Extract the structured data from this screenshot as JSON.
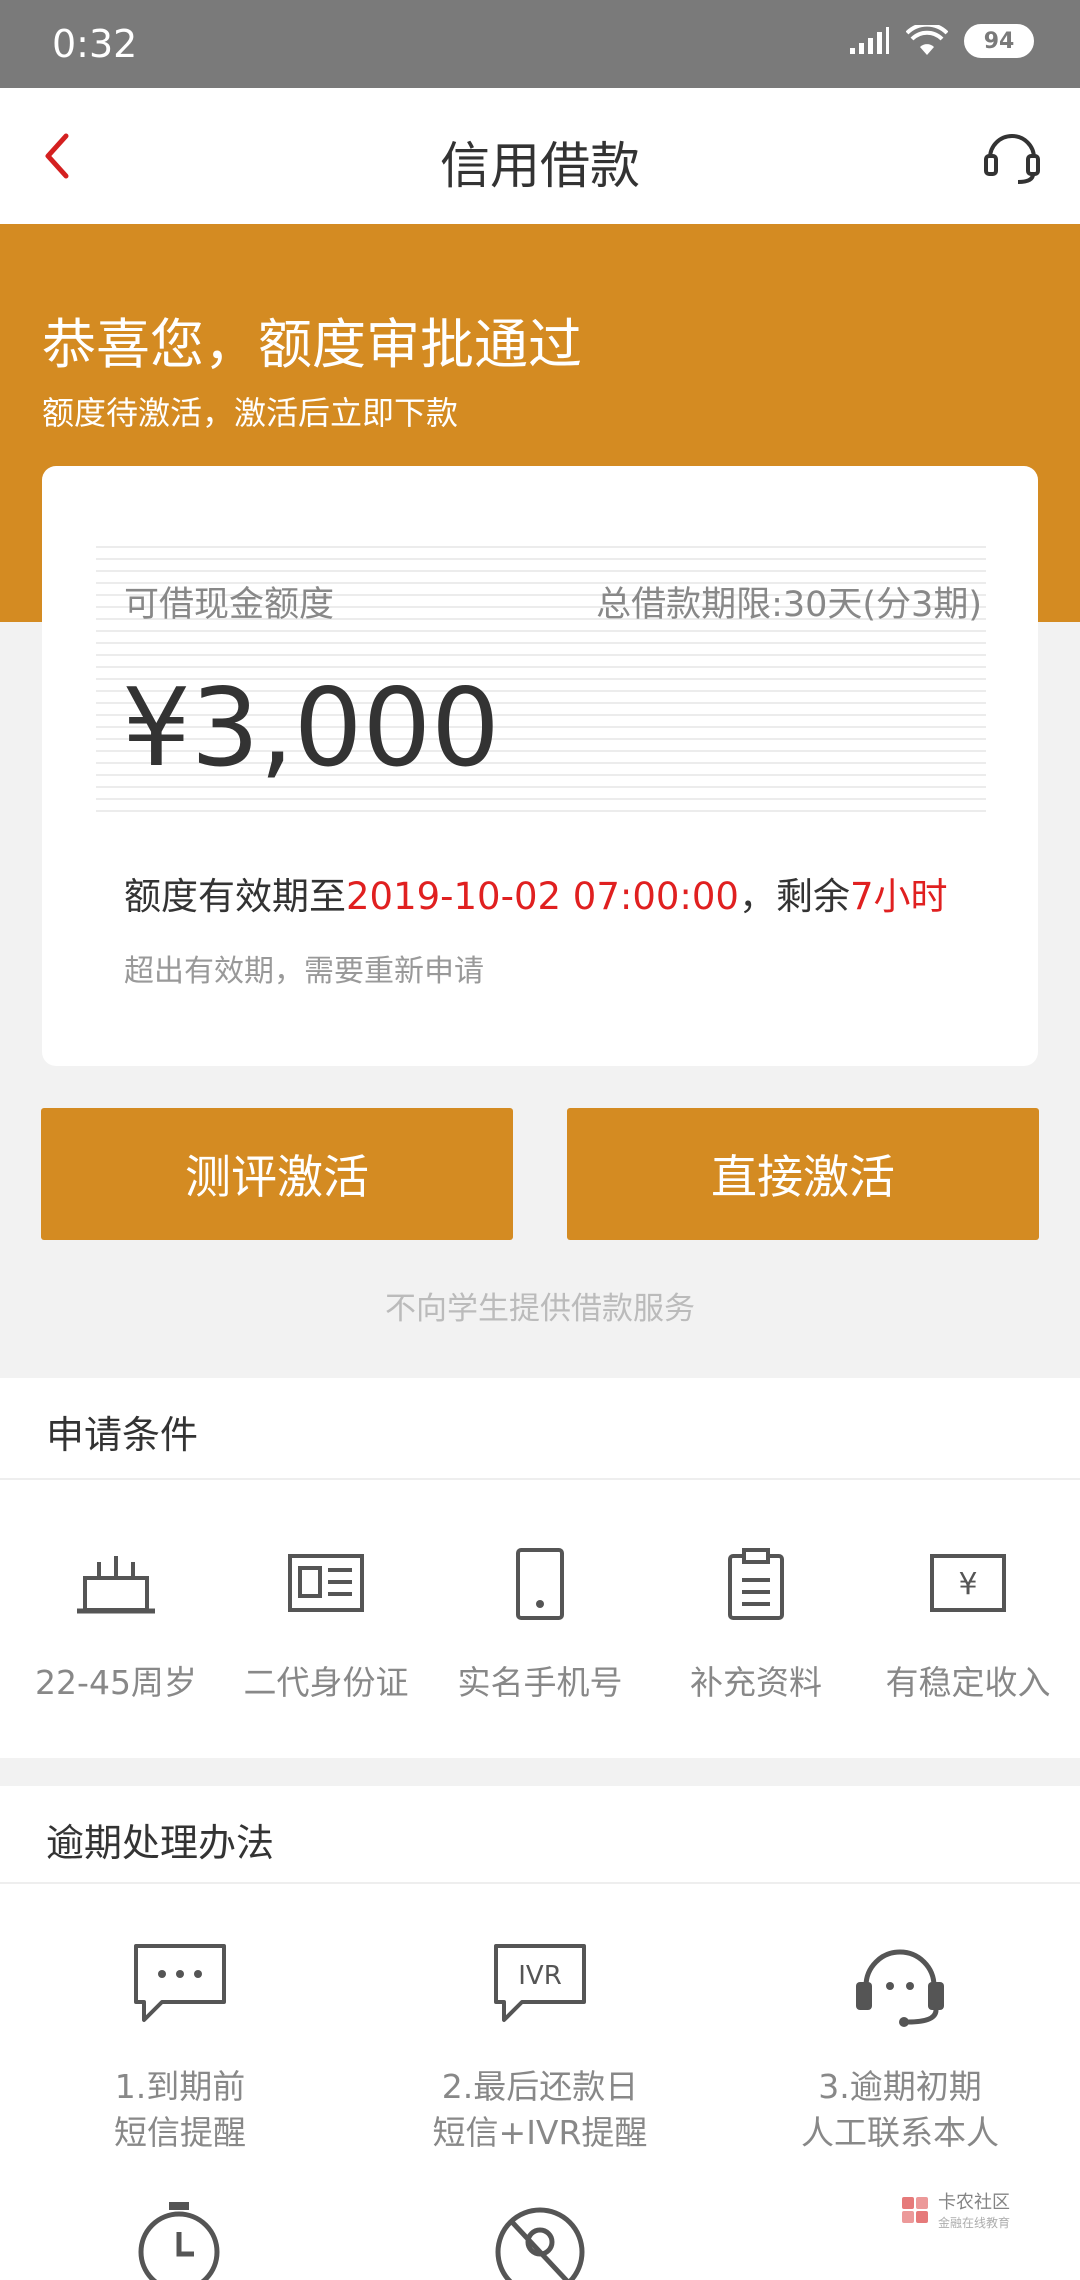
{
  "status_bar": {
    "time": "0:32",
    "battery": "94"
  },
  "nav": {
    "title": "信用借款"
  },
  "hero": {
    "headline": "恭喜您，额度审批通过",
    "subline": "额度待激活，激活后立即下款"
  },
  "card": {
    "label_left": "可借现金额度",
    "label_right": "总借款期限:30天(分3期)",
    "amount": "¥3,000",
    "valid_prefix": "额度有效期至",
    "valid_date": "2019-10-02 07:00:00",
    "valid_mid": "，剩余",
    "valid_remaining": "7小时",
    "sub_note": "超出有效期，需要重新申请"
  },
  "buttons": {
    "evaluate": "测评激活",
    "direct": "直接激活"
  },
  "notice": "不向学生提供借款服务",
  "conditions": {
    "title": "申请条件",
    "items": [
      {
        "label": "22-45周岁",
        "icon": "cake-icon"
      },
      {
        "label": "二代身份证",
        "icon": "id-card-icon"
      },
      {
        "label": "实名手机号",
        "icon": "phone-icon"
      },
      {
        "label": "补充资料",
        "icon": "clipboard-icon"
      },
      {
        "label": "有稳定收入",
        "icon": "income-icon"
      }
    ]
  },
  "overdue": {
    "title": "逾期处理办法",
    "items": [
      {
        "line1": "1.到期前",
        "line2": "短信提醒",
        "icon": "sms-icon"
      },
      {
        "line1": "2.最后还款日",
        "line2": "短信+IVR提醒",
        "icon": "ivr-icon",
        "icon_text": "IVR"
      },
      {
        "line1": "3.逾期初期",
        "line2": "人工联系本人",
        "icon": "headset-icon"
      }
    ]
  },
  "watermark": {
    "title": "卡农社区",
    "subtitle": "金融在线教育"
  },
  "colors": {
    "accent": "#d48b22",
    "red": "#e02020"
  }
}
